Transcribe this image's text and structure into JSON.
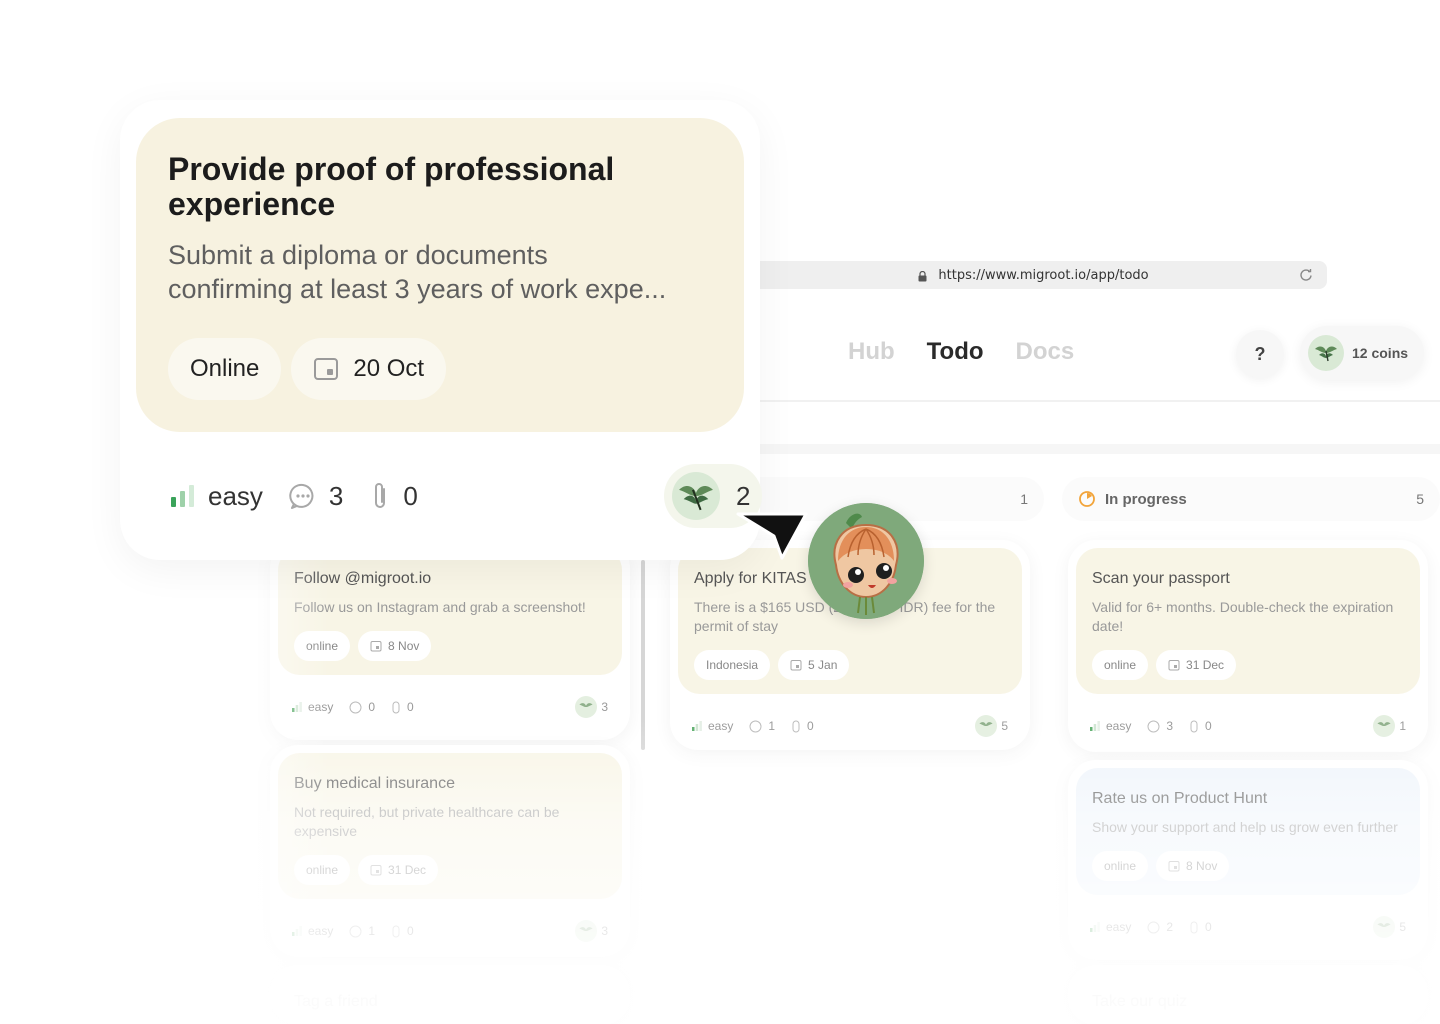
{
  "browser": {
    "url": "https://www.migroot.io/app/todo"
  },
  "nav": {
    "links": [
      "Hub",
      "Todo",
      "Docs"
    ],
    "active": "Todo",
    "help": "?",
    "coins": "12 coins"
  },
  "columns": [
    {
      "name": "",
      "count": "1"
    },
    {
      "name": "In progress",
      "count": "5"
    }
  ],
  "focus_card": {
    "title": "Provide proof of professional experience",
    "description_line1": "Submit a diploma or documents",
    "description_line2": "confirming at least 3 years of work expe...",
    "location": "Online",
    "date": "20 Oct",
    "difficulty": "easy",
    "comments": "3",
    "attachments": "0",
    "reward": "2"
  },
  "tasks": {
    "follow": {
      "title": "Follow @migroot.io",
      "desc": "Follow us on Instagram and grab a screenshot!",
      "loc": "online",
      "date": "8 Nov",
      "difficulty": "easy",
      "comments": "0",
      "attachments": "0",
      "reward": "3"
    },
    "insurance": {
      "title": "Buy medical insurance",
      "desc": "Not required, but private healthcare can be expensive",
      "loc": "online",
      "date": "31 Dec",
      "difficulty": "easy",
      "comments": "1",
      "attachments": "0",
      "reward": "3"
    },
    "tag": {
      "title": "Tag a friend"
    },
    "kitas": {
      "title": "Apply for KITAS",
      "desc": "There is a $165 USD (2,500,000 IDR) fee for the permit of stay",
      "loc": "Indonesia",
      "date": "5 Jan",
      "difficulty": "easy",
      "comments": "1",
      "attachments": "0",
      "reward": "5"
    },
    "passport": {
      "title": "Scan your passport",
      "desc": "Valid for 6+ months. Double-check the expiration date!",
      "loc": "online",
      "date": "31 Dec",
      "difficulty": "easy",
      "comments": "3",
      "attachments": "0",
      "reward": "1"
    },
    "producthunt": {
      "title": "Rate us on Product Hunt",
      "desc": "Show your support and help us grow even further",
      "loc": "online",
      "date": "8 Nov",
      "difficulty": "easy",
      "comments": "2",
      "attachments": "0",
      "reward": "5"
    },
    "quiz": {
      "title": "Take our quiz"
    }
  },
  "colors": {
    "card_beige": "#f7f2e0",
    "card_blue": "#eef4fb",
    "coin_green": "#d9e9d5",
    "difficulty_green": "#3aa35a"
  }
}
